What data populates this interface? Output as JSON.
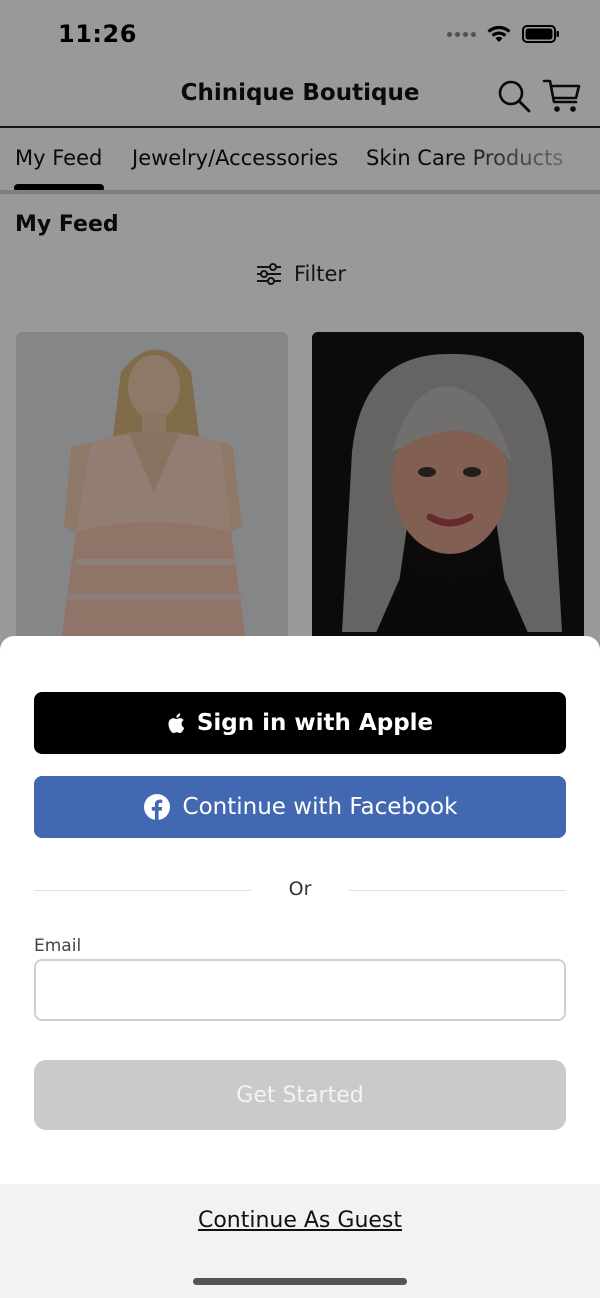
{
  "status_bar": {
    "time": "11:26"
  },
  "header": {
    "title": "Chinique Boutique"
  },
  "tabs": [
    {
      "label": "My Feed"
    },
    {
      "label": "Jewelry/Accessories"
    },
    {
      "label": "Skin Care Products"
    }
  ],
  "feed": {
    "heading": "My Feed",
    "filter_label": "Filter"
  },
  "sheet": {
    "apple_label": "Sign in with Apple",
    "facebook_label": "Continue with Facebook",
    "divider_text": "Or",
    "email_label": "Email",
    "email_value": "",
    "get_started_label": "Get Started",
    "guest_label": "Continue As Guest"
  },
  "colors": {
    "facebook": "#4268b2",
    "apple": "#000000",
    "disabled_button": "#cacaca",
    "overlay": "rgba(0,0,0,0.4)"
  }
}
